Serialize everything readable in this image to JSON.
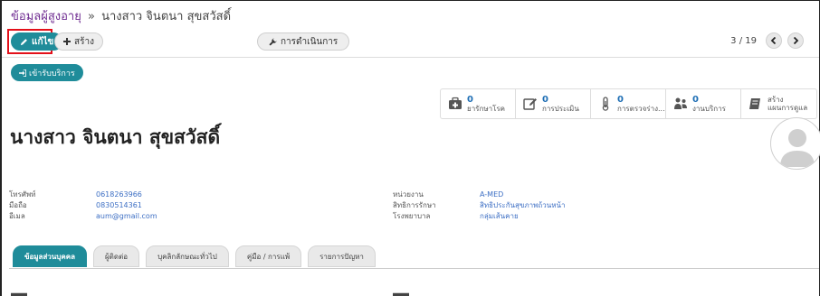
{
  "breadcrumb": {
    "parent": "ข้อมูลผู้สูงอายุ",
    "separator": "»",
    "current": "นางสาว จินตนา สุขสวัสดิ์"
  },
  "toolbar": {
    "edit_label": "แก้ไข",
    "create_label": "สร้าง",
    "action_label": "การดำเนินการ"
  },
  "pager": {
    "value": "3 / 19"
  },
  "checkin_label": "เข้ารับบริการ",
  "stats": [
    {
      "icon": "medical-kit-icon",
      "count": "0",
      "label": "ยารักษาโรค"
    },
    {
      "icon": "edit-note-icon",
      "count": "0",
      "label": "การประเมิน"
    },
    {
      "icon": "thermometer-icon",
      "count": "0",
      "label": "การตรวจร่าง..."
    },
    {
      "icon": "people-icon",
      "count": "0",
      "label": "งานบริการ"
    },
    {
      "icon": "book-icon",
      "count": "สร้าง",
      "label": "แผนการดูแล"
    }
  ],
  "patient": {
    "name": "นางสาว จินตนา สุขสวัสดิ์"
  },
  "contact": {
    "phone_label": "โทรศัพท์",
    "phone_value": "0618263966",
    "mobile_label": "มือถือ",
    "mobile_value": "0830514361",
    "email_label": "อีเมล",
    "email_value": "aum@gmail.com"
  },
  "org": {
    "unit_label": "หน่วยงาน",
    "unit_value": "A-MED",
    "right_label": "สิทธิการรักษา",
    "right_value": "สิทธิประกันสุขภาพถ้วนหน้า",
    "hospital_label": "โรงพยาบาล",
    "hospital_value": "กลุ่มเส้นคาย"
  },
  "tabs": [
    {
      "label": "ข้อมูลส่วนบุคคล",
      "active": true
    },
    {
      "label": "ผู้ติดต่อ",
      "active": false
    },
    {
      "label": "บุคลิกลักษณะทั่วไป",
      "active": false
    },
    {
      "label": "คู่มือ / การแพ้",
      "active": false
    },
    {
      "label": "รายการปัญหา",
      "active": false
    }
  ],
  "colors": {
    "primary": "#1f8c9a",
    "link": "#6f2c91",
    "value": "#3d6fc4",
    "highlight": "#e3101a"
  }
}
